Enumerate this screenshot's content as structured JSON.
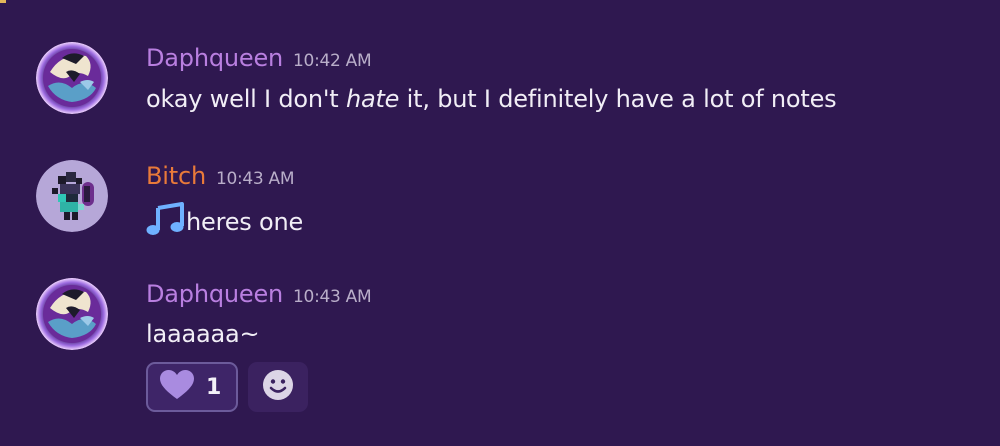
{
  "colors": {
    "background": "#2f1850",
    "daphqueen": "#b97fe0",
    "bitch": "#e97a3a",
    "timestamp": "#b9aec9",
    "text": "#f1eef6",
    "reaction_border": "#6c5b9b",
    "heart": "#a98be0"
  },
  "messages": [
    {
      "username": "Daphqueen",
      "timestamp": "10:42 AM",
      "text_before": "okay well I don't ",
      "text_italic": "hate",
      "text_after": " it, but I definitely have a lot of notes"
    },
    {
      "username": "Bitch",
      "timestamp": "10:43 AM",
      "emoji": "musical-notes-emoji",
      "text": "heres one"
    },
    {
      "username": "Daphqueen",
      "timestamp": "10:43 AM",
      "text": "laaaaaa~",
      "reactions": [
        {
          "emoji": "purple-heart-icon",
          "count": "1"
        }
      ],
      "add_reaction_icon": "smiley-icon"
    }
  ]
}
